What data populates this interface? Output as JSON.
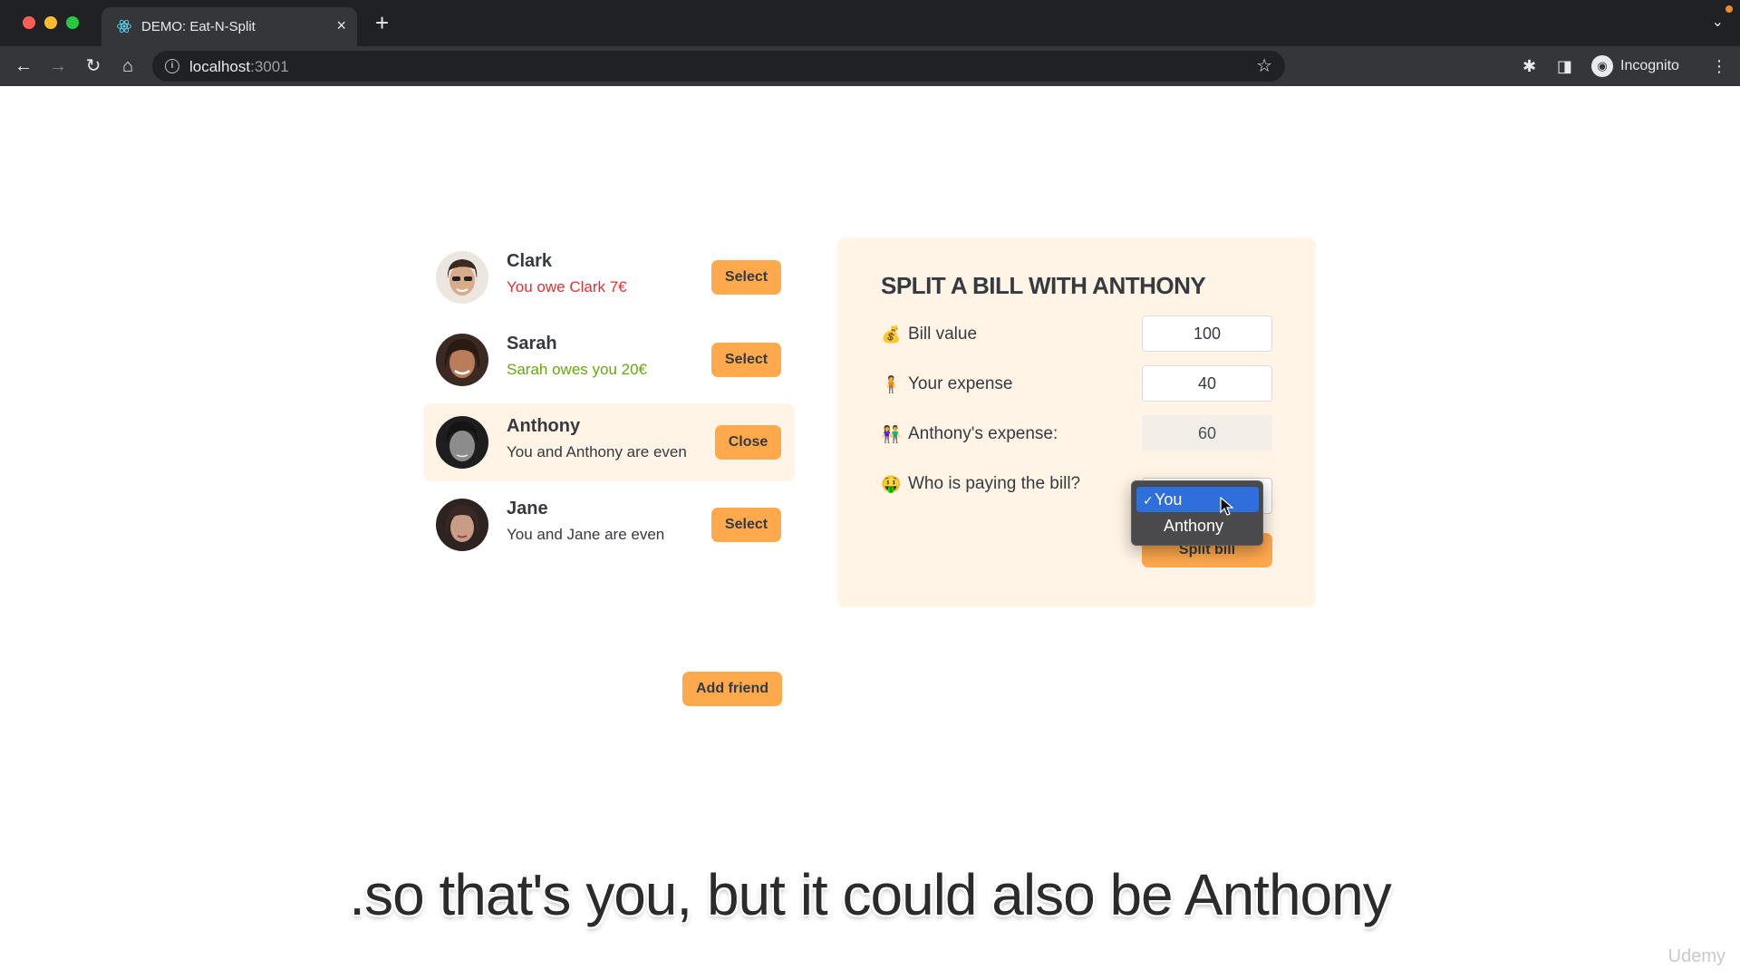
{
  "browser": {
    "tab_title": "DEMO: Eat-N-Split",
    "tab_close": "×",
    "new_tab": "+",
    "tab_menu": "⌄",
    "url_host": "localhost",
    "url_port": ":3001",
    "profile_label": "Incognito",
    "icons": [
      "back-icon",
      "forward-icon",
      "reload-icon",
      "home-icon",
      "info-icon",
      "star-icon",
      "extensions-icon",
      "sidepanel-icon",
      "menu-icon"
    ]
  },
  "friends": [
    {
      "name": "Clark",
      "status": "You owe Clark 7€",
      "status_tone": "negative",
      "button": "Select",
      "selected": false
    },
    {
      "name": "Sarah",
      "status": "Sarah owes you 20€",
      "status_tone": "positive",
      "button": "Select",
      "selected": false
    },
    {
      "name": "Anthony",
      "status": "You and Anthony are even",
      "status_tone": "neutral",
      "button": "Close",
      "selected": true
    },
    {
      "name": "Jane",
      "status": "You and Jane are even",
      "status_tone": "neutral",
      "button": "Select",
      "selected": false
    }
  ],
  "add_friend_label": "Add friend",
  "split_form": {
    "title": "SPLIT A BILL WITH ANTHONY",
    "bill_label": "Bill value",
    "bill_value": "100",
    "bill_emoji": "💰",
    "your_expense_label": "Your expense",
    "your_expense_value": "40",
    "your_expense_emoji": "🧍",
    "friend_expense_label": "Anthony's expense:",
    "friend_expense_value": "60",
    "friend_expense_emoji": "👫",
    "payer_label": "Who is paying the bill?",
    "payer_emoji": "🤑",
    "payer_options": [
      "You",
      "Anthony"
    ],
    "payer_selected": "You",
    "check_mark": "✓",
    "submit_label": "Split bill"
  },
  "colors": {
    "accent": "#ffa94d",
    "panel_bg": "#fff4e6",
    "text": "#343a40",
    "negative": "#e03131",
    "positive": "#66a80f",
    "dropdown_bg": "#4a4a4c",
    "dropdown_highlight": "#2f6fdc"
  },
  "caption": ".so that's you, but it could also be Anthony",
  "watermark": "Udemy"
}
